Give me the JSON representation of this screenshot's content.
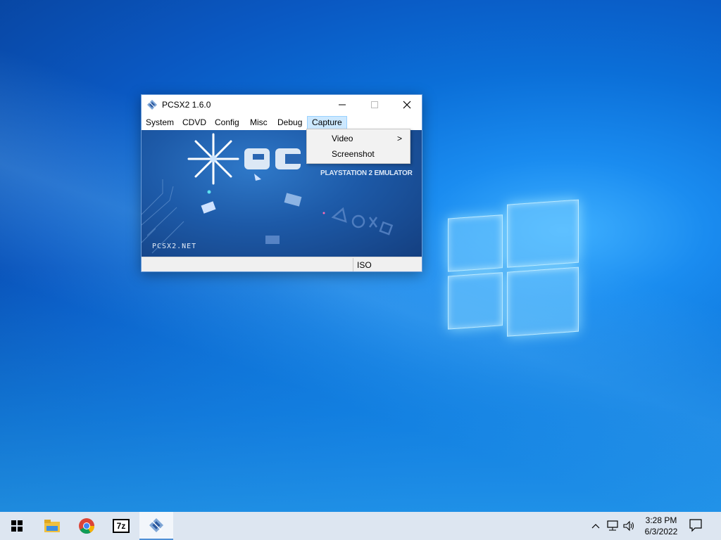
{
  "window": {
    "title": "PCSX2  1.6.0",
    "minimize_icon": "minimize-icon",
    "maximize_icon": "maximize-icon",
    "close_icon": "close-icon"
  },
  "menubar": {
    "items": [
      {
        "label": "System"
      },
      {
        "label": "CDVD"
      },
      {
        "label": "Config"
      },
      {
        "label": "Misc"
      },
      {
        "label": "Debug"
      },
      {
        "label": "Capture",
        "active": true
      }
    ]
  },
  "capture_menu": {
    "items": [
      {
        "label": "Video",
        "submenu_arrow": ">"
      },
      {
        "label": "Screenshot"
      }
    ]
  },
  "splash": {
    "logo_text": "PCSX2",
    "subtitle": "PLAYSTATION 2 EMULATOR",
    "site": "PCSX2.NET"
  },
  "statusbar": {
    "mode": "ISO"
  },
  "taskbar": {
    "apps": [
      {
        "icon": "windows-start-icon"
      },
      {
        "icon": "file-explorer-icon"
      },
      {
        "icon": "chrome-icon"
      },
      {
        "icon": "7zip-icon",
        "label": "7z"
      },
      {
        "icon": "pcsx2-icon",
        "active": true
      }
    ],
    "tray": {
      "icons": [
        "chevron-up-icon",
        "network-icon",
        "volume-icon"
      ]
    },
    "clock": {
      "time": "3:28 PM",
      "date": "6/3/2022"
    }
  },
  "colors": {
    "accent": "#0b6fd8",
    "menu_highlight": "#cce8ff",
    "taskbar": "#dde6f1"
  }
}
